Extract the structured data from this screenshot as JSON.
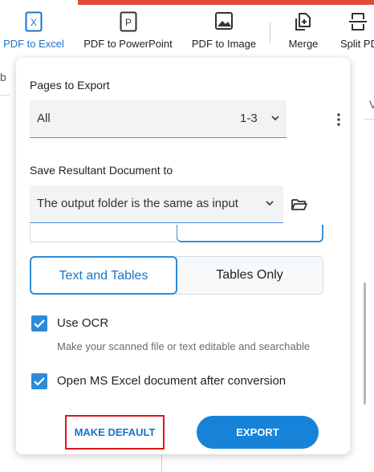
{
  "toolbar": {
    "items": [
      {
        "label": "PDF to Excel",
        "icon": "excel-file-icon",
        "glyph": "X"
      },
      {
        "label": "PDF to PowerPoint",
        "icon": "powerpoint-file-icon",
        "glyph": "P"
      },
      {
        "label": "PDF to Image",
        "icon": "image-file-icon"
      },
      {
        "label": "Merge",
        "icon": "merge-icon"
      },
      {
        "label": "Split PD",
        "icon": "split-icon"
      }
    ]
  },
  "background": {
    "left_char": "b",
    "right_char": "V"
  },
  "pages": {
    "label": "Pages to Export",
    "selected": "All",
    "range": "1-3"
  },
  "save": {
    "label": "Save Resultant Document to",
    "selected": "The output folder is the same as input"
  },
  "mode": {
    "options": [
      "Text and Tables",
      "Tables Only"
    ],
    "selected": "Text and Tables"
  },
  "ocr": {
    "label": "Use OCR",
    "checked": true,
    "hint": "Make your scanned file or text editable and searchable"
  },
  "open_after": {
    "label": "Open MS Excel document after conversion",
    "checked": true
  },
  "actions": {
    "make_default": "MAKE DEFAULT",
    "export": "EXPORT"
  },
  "colors": {
    "accent": "#1683d8",
    "top_bar": "#e04b3a",
    "highlight_border": "#e2141a"
  }
}
